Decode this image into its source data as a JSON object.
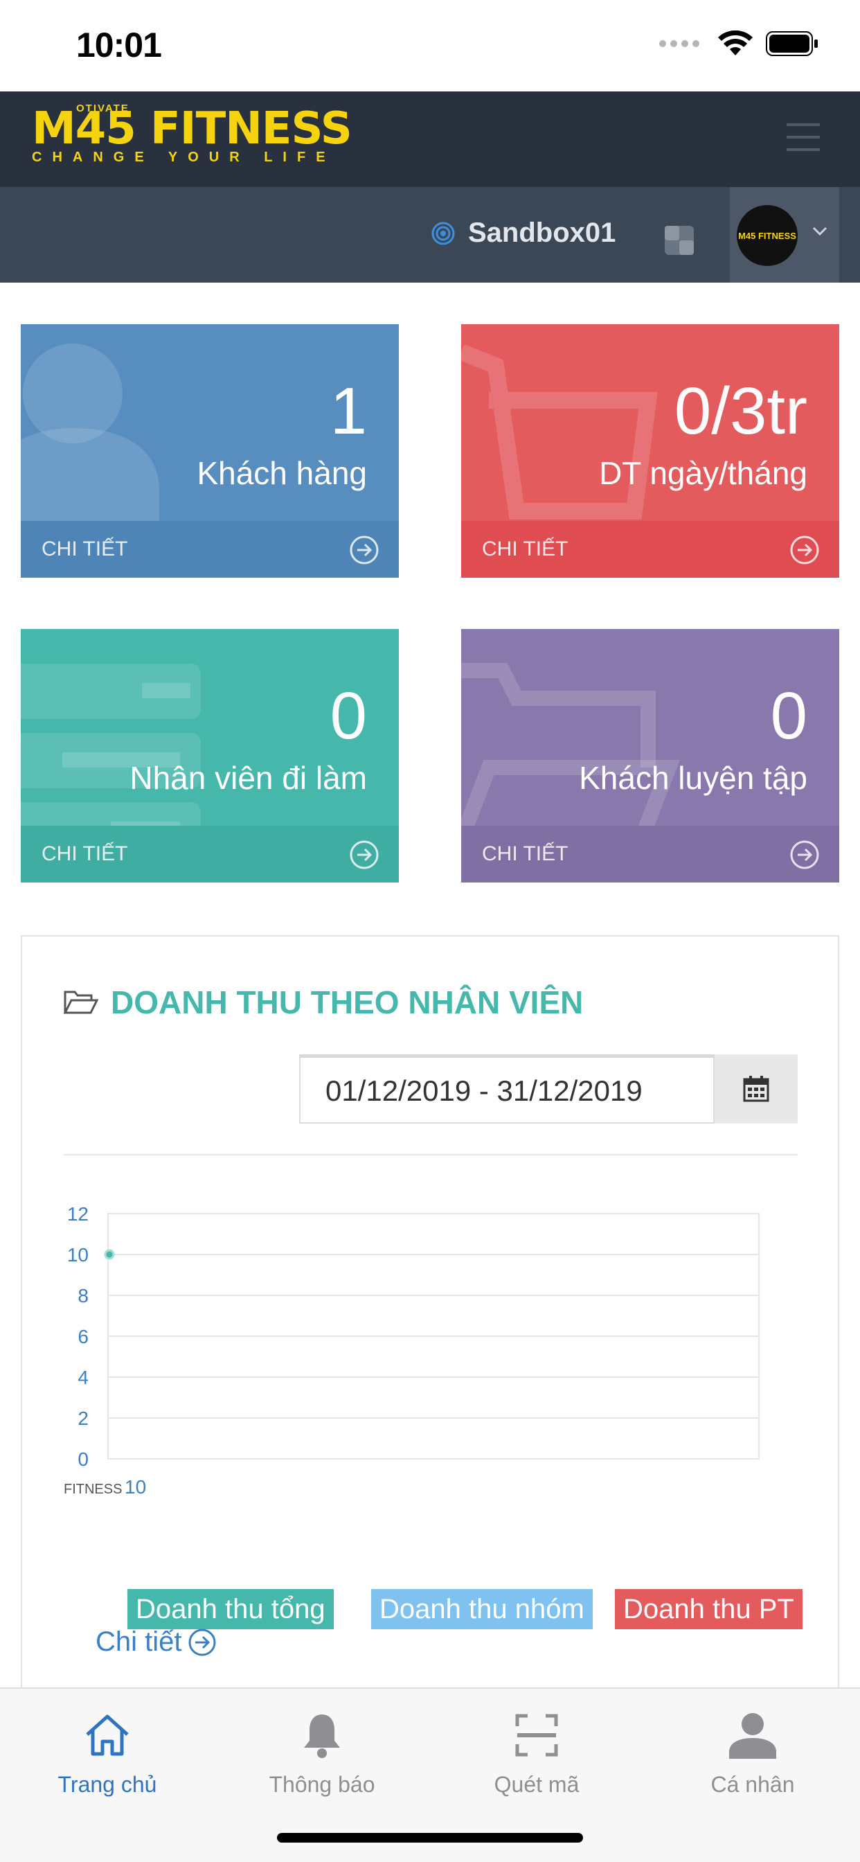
{
  "status_bar": {
    "time": "10:01"
  },
  "header": {
    "logo_main": "M45 FITNESS",
    "logo_otivate": "OTIVATE",
    "logo_tagline": "CHANGE YOUR LIFE"
  },
  "subheader": {
    "workspace": "Sandbox01",
    "avatar_text": "M45 FITNESS"
  },
  "tiles": [
    {
      "value": "1",
      "label": "Khách hàng",
      "footer": "CHI TIẾT",
      "color": "#578ebf"
    },
    {
      "value": "0/3tr",
      "label": "DT ngày/tháng",
      "footer": "CHI TIẾT",
      "color": "#e45b5e"
    },
    {
      "value": "0",
      "label": "Nhân viên đi làm",
      "footer": "CHI TIẾT",
      "color": "#46b7ab"
    },
    {
      "value": "0",
      "label": "Khách luyện tập",
      "footer": "CHI TIẾT",
      "color": "#8878ab"
    }
  ],
  "panel": {
    "title": "DOANH THU THEO NHÂN VIÊN",
    "date_range": "01/12/2019 - 31/12/2019",
    "legend": [
      "Doanh thu tổng",
      "Doanh thu nhóm",
      "Doanh thu PT"
    ],
    "detail_link": "Chi tiết"
  },
  "chart_data": {
    "type": "line",
    "categories": [
      "FITNESS 10"
    ],
    "category_prefix": "FITNESS",
    "category_suffix": "10",
    "series": [
      {
        "name": "Doanh thu tổng",
        "values": [
          10
        ],
        "color": "#46b7ab"
      }
    ],
    "ylim": [
      0,
      12
    ],
    "yticks": [
      0,
      2,
      4,
      6,
      8,
      10,
      12
    ],
    "grid": true
  },
  "tabbar": {
    "tabs": [
      {
        "label": "Trang chủ",
        "icon": "home-icon",
        "active": true
      },
      {
        "label": "Thông báo",
        "icon": "bell-icon",
        "active": false
      },
      {
        "label": "Quét mã",
        "icon": "scan-icon",
        "active": false
      },
      {
        "label": "Cá nhân",
        "icon": "person-icon",
        "active": false
      }
    ]
  },
  "colors": {
    "accent": "#46b7ab",
    "link": "#3b7fc4",
    "header": "#28313d",
    "logo": "#f5d40f"
  }
}
